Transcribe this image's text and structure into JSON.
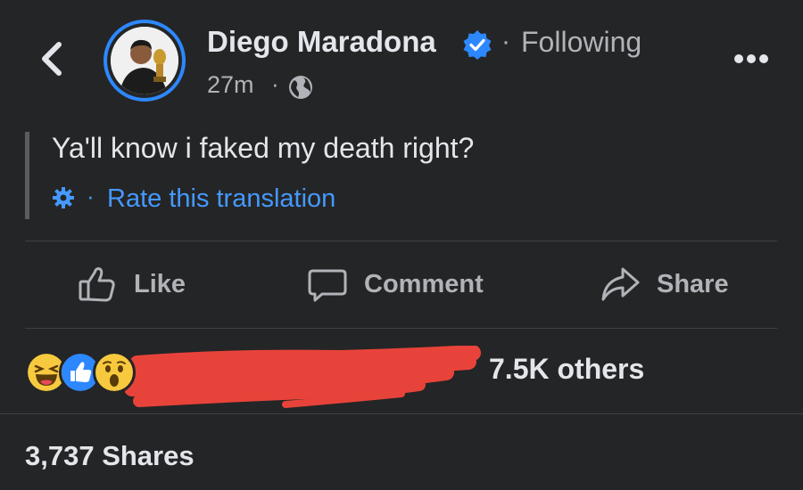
{
  "post": {
    "author": "Diego Maradona",
    "follow_status": "Following",
    "separator": "·",
    "time": "27m",
    "text": "Ya'll know i faked my death right?",
    "translation_link": "Rate this translation"
  },
  "actions": {
    "like": "Like",
    "comment": "Comment",
    "share": "Share"
  },
  "reactions": {
    "types": [
      "haha",
      "like",
      "wow"
    ],
    "count_text": "7.5K others"
  },
  "shares_text": "3,737 Shares",
  "colors": {
    "background": "#242526",
    "accent_blue": "#2d88ff",
    "link_blue": "#4599ff",
    "muted_text": "#b0b3b8",
    "redaction_red": "#e8433a"
  },
  "icons": [
    "back-arrow-icon",
    "verified-badge-icon",
    "more-options-icon",
    "globe-icon",
    "gear-icon",
    "thumbs-up-icon",
    "comment-bubble-icon",
    "share-arrow-icon"
  ]
}
